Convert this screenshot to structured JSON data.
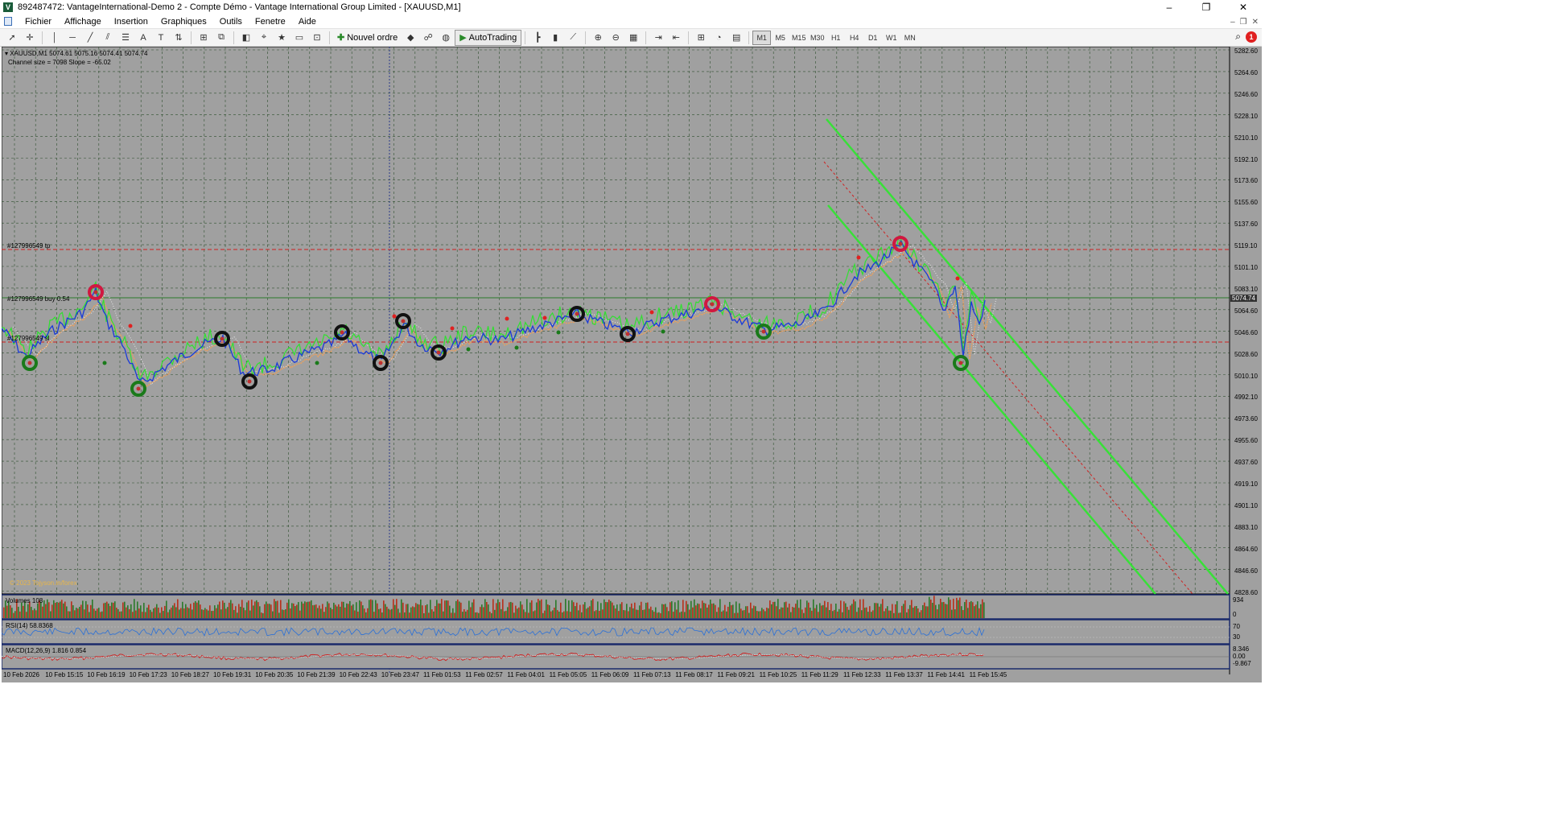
{
  "window": {
    "title": "892487472: VantageInternational-Demo 2 - Compte Démo - Vantage International Group Limited - [XAUUSD,M1]",
    "controls": [
      "–",
      "❐",
      "✕"
    ]
  },
  "menu": {
    "items": [
      "Fichier",
      "Affichage",
      "Insertion",
      "Graphiques",
      "Outils",
      "Fenetre",
      "Aide"
    ]
  },
  "toolbar": {
    "new_order_label": "Nouvel ordre",
    "autotrading_label": "AutoTrading",
    "timeframes": [
      "M1",
      "M5",
      "M15",
      "M30",
      "H1",
      "H4",
      "D1",
      "W1",
      "MN"
    ],
    "active_timeframe": "M1",
    "notification_count": "1"
  },
  "chart": {
    "symbol_line": "XAUUSD,M1  5074.61 5075.16 5074.41 5074.74",
    "channel_info": "Channel size = 7098 Slope = -65.02",
    "order_tp_label": "#127996549 tp",
    "order_buy_label": "#127996549 buy 0.54",
    "order_sl_label": "#127996549 sl",
    "current_price": "5074.74",
    "copyright": "© 2023 Tojyson.in/forex",
    "background_color": "#a0a0a0",
    "grid_color": "#3a5a3a",
    "price_labels": [
      "5282.60",
      "5264.60",
      "5246.60",
      "5228.10",
      "5210.10",
      "5192.10",
      "5173.60",
      "5155.60",
      "5137.60",
      "5119.10",
      "5101.10",
      "5083.10",
      "5064.60",
      "5046.60",
      "5028.60",
      "5010.10",
      "4992.10",
      "4973.60",
      "4955.60",
      "4937.60",
      "4919.10",
      "4901.10",
      "4883.10",
      "4864.60",
      "4846.60",
      "4828.60"
    ],
    "time_labels": [
      "10 Feb 2026",
      "10 Feb 15:15",
      "10 Feb 16:19",
      "10 Feb 17:23",
      "10 Feb 18:27",
      "10 Feb 19:31",
      "10 Feb 20:35",
      "10 Feb 21:39",
      "10 Feb 22:43",
      "10 Feb 23:47",
      "11 Feb 01:53",
      "11 Feb 02:57",
      "11 Feb 04:01",
      "11 Feb 05:05",
      "11 Feb 06:09",
      "11 Feb 07:13",
      "11 Feb 08:17",
      "11 Feb 09:21",
      "11 Feb 10:25",
      "11 Feb 11:29",
      "11 Feb 12:33",
      "11 Feb 13:37",
      "11 Feb 14:41",
      "11 Feb 15:45"
    ]
  },
  "volumes": {
    "label": "Volumes 108",
    "scale_top": "934",
    "scale_bottom": "0"
  },
  "rsi": {
    "label": "RSI(14) 58.8368",
    "scale_top": "70",
    "scale_bottom": "30"
  },
  "macd": {
    "label": "MACD(12,26,9) 1.816 0.854",
    "scale_top": "8.346",
    "scale_mid": "0.00",
    "scale_bottom": "-9.867"
  }
}
